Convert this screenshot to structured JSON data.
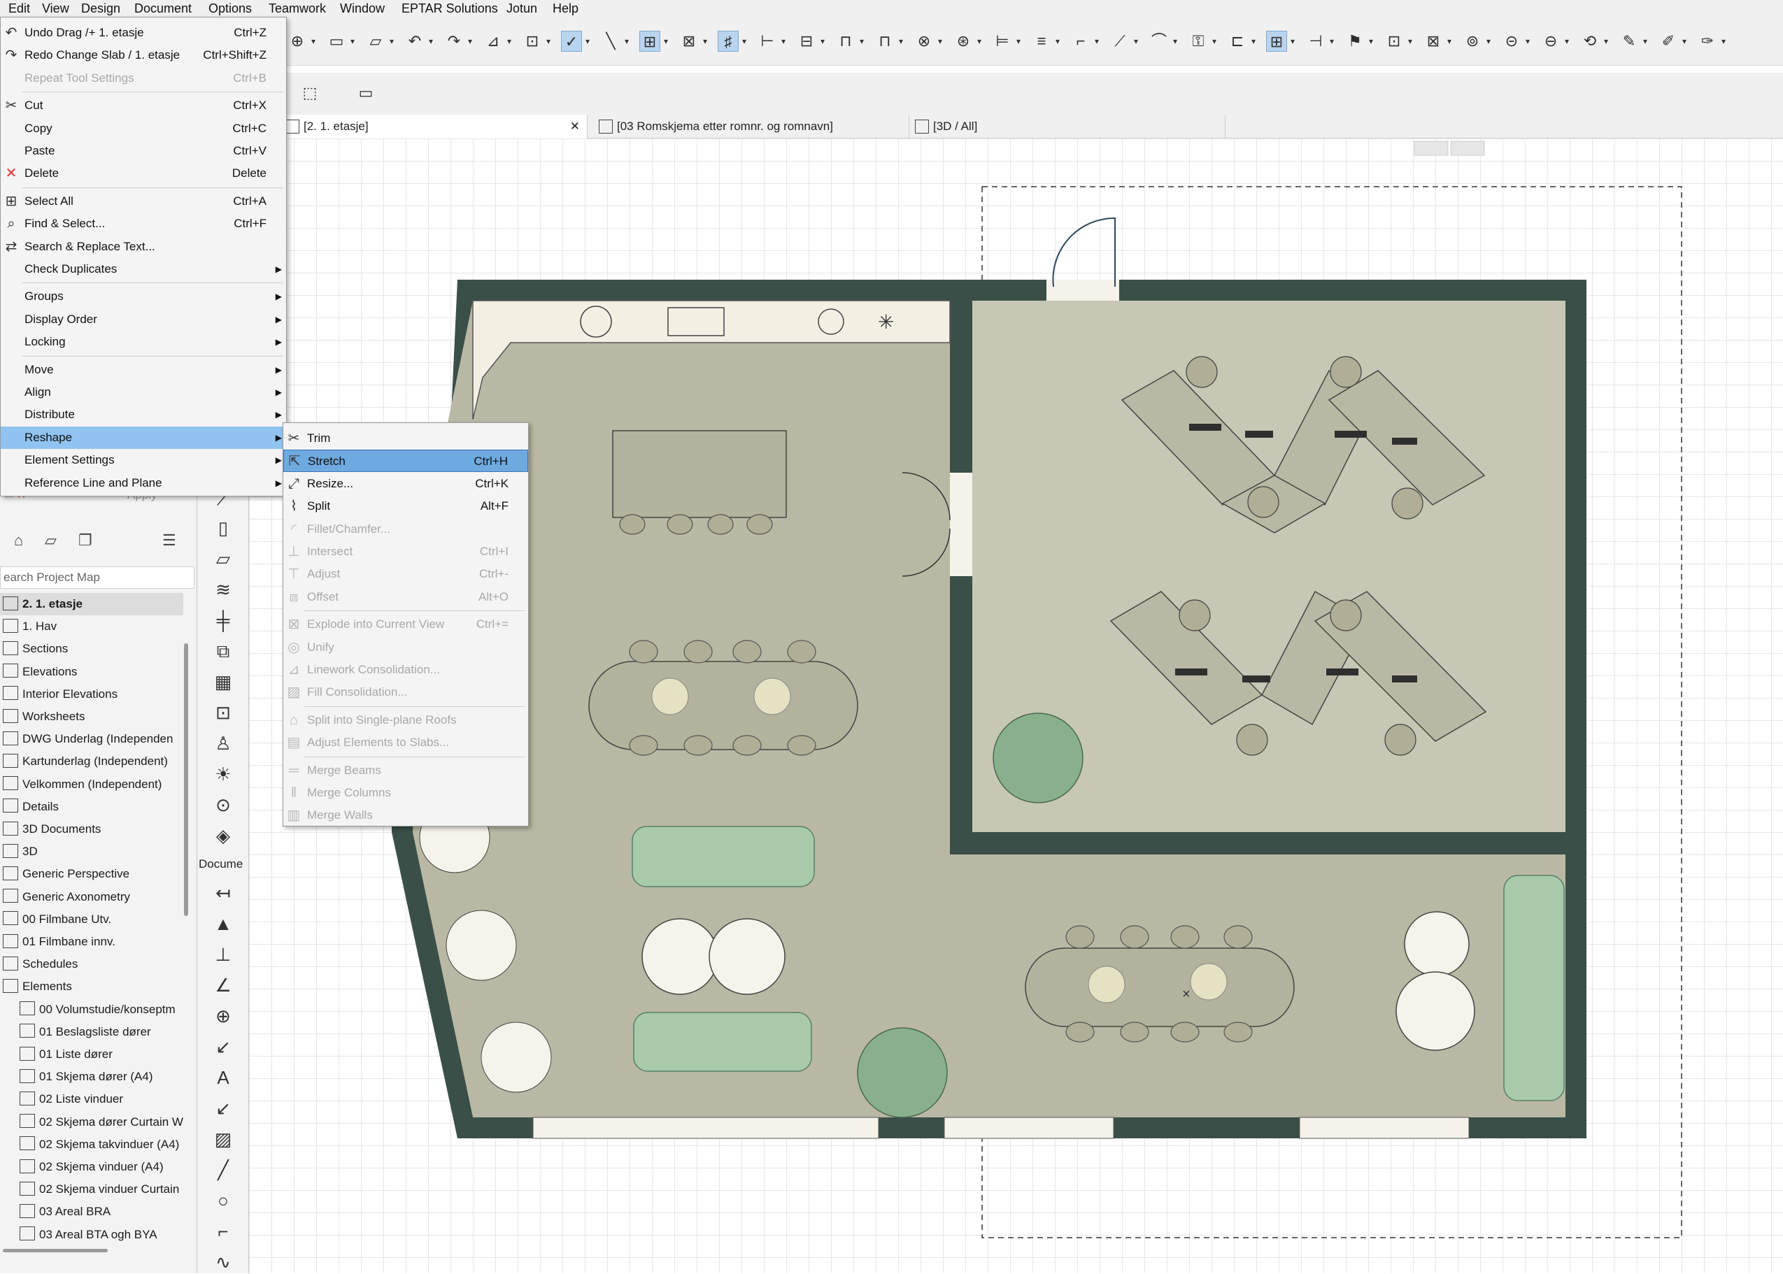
{
  "menubar": [
    "Edit",
    "View",
    "Design",
    "Document",
    "Options",
    "Teamwork",
    "Window",
    "EPTAR Solutions",
    "Jotun",
    "Help"
  ],
  "tabs": [
    {
      "label": "[2. 1. etasje]",
      "icon": "floorplan-icon"
    },
    {
      "label": "[03 Romskjema etter romnr. og romnavn]",
      "icon": "schedule-icon"
    },
    {
      "label": "[3D / All]",
      "icon": "3d-icon"
    }
  ],
  "edit_menu": [
    {
      "label": "Undo Drag /+ 1. etasje",
      "shortcut": "Ctrl+Z",
      "icon": "undo-icon",
      "disabled": false
    },
    {
      "label": "Redo Change Slab / 1. etasje",
      "shortcut": "Ctrl+Shift+Z",
      "icon": "redo-icon",
      "disabled": false
    },
    {
      "label": "Repeat Tool Settings",
      "shortcut": "Ctrl+B",
      "icon": "",
      "disabled": true
    },
    {
      "sep": true
    },
    {
      "label": "Cut",
      "shortcut": "Ctrl+X",
      "icon": "scissors-icon",
      "disabled": false
    },
    {
      "label": "Copy",
      "shortcut": "Ctrl+C",
      "icon": "",
      "disabled": false
    },
    {
      "label": "Paste",
      "shortcut": "Ctrl+V",
      "icon": "",
      "disabled": false
    },
    {
      "label": "Delete",
      "shortcut": "Delete",
      "icon": "delete-icon",
      "disabled": false
    },
    {
      "sep": true
    },
    {
      "label": "Select All",
      "shortcut": "Ctrl+A",
      "icon": "select-all-icon",
      "disabled": false
    },
    {
      "label": "Find & Select...",
      "shortcut": "Ctrl+F",
      "icon": "find-icon",
      "disabled": false
    },
    {
      "label": "Search & Replace Text...",
      "shortcut": "",
      "icon": "search-replace-icon",
      "disabled": false
    },
    {
      "label": "Check Duplicates",
      "shortcut": "",
      "icon": "",
      "disabled": false,
      "submenu": true
    },
    {
      "sep": true
    },
    {
      "label": "Groups",
      "shortcut": "",
      "icon": "",
      "disabled": false,
      "submenu": true
    },
    {
      "label": "Display Order",
      "shortcut": "",
      "icon": "",
      "disabled": false,
      "submenu": true
    },
    {
      "label": "Locking",
      "shortcut": "",
      "icon": "",
      "disabled": false,
      "submenu": true
    },
    {
      "sep": true
    },
    {
      "label": "Move",
      "shortcut": "",
      "icon": "",
      "disabled": false,
      "submenu": true
    },
    {
      "label": "Align",
      "shortcut": "",
      "icon": "",
      "disabled": false,
      "submenu": true
    },
    {
      "label": "Distribute",
      "shortcut": "",
      "icon": "",
      "disabled": false,
      "submenu": true
    },
    {
      "label": "Reshape",
      "shortcut": "",
      "icon": "",
      "disabled": false,
      "submenu": true,
      "highlighted": true
    },
    {
      "label": "Element Settings",
      "shortcut": "",
      "icon": "",
      "disabled": false,
      "submenu": true
    },
    {
      "label": "Reference Line and Plane",
      "shortcut": "",
      "icon": "",
      "disabled": false,
      "submenu": true
    }
  ],
  "reshape_menu": [
    {
      "label": "Trim",
      "shortcut": "",
      "icon": "trim-icon",
      "disabled": false
    },
    {
      "label": "Stretch",
      "shortcut": "Ctrl+H",
      "icon": "stretch-icon",
      "disabled": false,
      "highlighted": true
    },
    {
      "label": "Resize...",
      "shortcut": "Ctrl+K",
      "icon": "resize-icon",
      "disabled": false
    },
    {
      "label": "Split",
      "shortcut": "Alt+F",
      "icon": "split-icon",
      "disabled": false
    },
    {
      "label": "Fillet/Chamfer...",
      "shortcut": "",
      "icon": "fillet-icon",
      "disabled": true
    },
    {
      "label": "Intersect",
      "shortcut": "Ctrl+I",
      "icon": "intersect-icon",
      "disabled": true
    },
    {
      "label": "Adjust",
      "shortcut": "Ctrl+-",
      "icon": "adjust-icon",
      "disabled": true
    },
    {
      "label": "Offset",
      "shortcut": "Alt+O",
      "icon": "offset-icon",
      "disabled": true
    },
    {
      "sep": true
    },
    {
      "label": "Explode into Current View",
      "shortcut": "Ctrl+=",
      "icon": "explode-icon",
      "disabled": true
    },
    {
      "label": "Unify",
      "shortcut": "",
      "icon": "unify-icon",
      "disabled": true
    },
    {
      "label": "Linework Consolidation...",
      "shortcut": "",
      "icon": "linework-icon",
      "disabled": true
    },
    {
      "label": "Fill Consolidation...",
      "shortcut": "",
      "icon": "fill-icon",
      "disabled": true
    },
    {
      "sep": true
    },
    {
      "label": "Split into Single-plane Roofs",
      "shortcut": "",
      "icon": "roof-icon",
      "disabled": true
    },
    {
      "label": "Adjust Elements to Slabs...",
      "shortcut": "",
      "icon": "slab-icon",
      "disabled": true
    },
    {
      "sep": true
    },
    {
      "label": "Merge Beams",
      "shortcut": "",
      "icon": "beam-icon",
      "disabled": true
    },
    {
      "label": "Merge Columns",
      "shortcut": "",
      "icon": "column-icon",
      "disabled": true
    },
    {
      "label": "Merge Walls",
      "shortcut": "",
      "icon": "wall-icon",
      "disabled": true
    }
  ],
  "panel": {
    "apply_label": "Apply",
    "search_placeholder": "earch Project Map",
    "toolbox_label": "Docume"
  },
  "project_map": [
    {
      "label": "2. 1. etasje",
      "indent": 0,
      "selected": true
    },
    {
      "label": "1. Hav",
      "indent": 0
    },
    {
      "label": "Sections",
      "indent": 0
    },
    {
      "label": "Elevations",
      "indent": 0
    },
    {
      "label": "Interior Elevations",
      "indent": 0
    },
    {
      "label": "Worksheets",
      "indent": 0
    },
    {
      "label": "DWG Underlag (Independen",
      "indent": 0
    },
    {
      "label": "Kartunderlag (Independent)",
      "indent": 0
    },
    {
      "label": "Velkommen (Independent)",
      "indent": 0
    },
    {
      "label": "Details",
      "indent": 0
    },
    {
      "label": "3D Documents",
      "indent": 0
    },
    {
      "label": "3D",
      "indent": 0
    },
    {
      "label": "Generic Perspective",
      "indent": 0
    },
    {
      "label": "Generic Axonometry",
      "indent": 0
    },
    {
      "label": "00 Filmbane Utv.",
      "indent": 0
    },
    {
      "label": "01 Filmbane innv.",
      "indent": 0
    },
    {
      "label": "Schedules",
      "indent": 0
    },
    {
      "label": "Elements",
      "indent": 0
    },
    {
      "label": "00 Volumstudie/konseptm",
      "indent": 1
    },
    {
      "label": "01 Beslagsliste dører",
      "indent": 1
    },
    {
      "label": "01 Liste dører",
      "indent": 1
    },
    {
      "label": "01 Skjema dører (A4)",
      "indent": 1
    },
    {
      "label": "02 Liste vinduer",
      "indent": 1
    },
    {
      "label": "02 Skjema dører Curtain W",
      "indent": 1
    },
    {
      "label": "02 Skjema takvinduer (A4)",
      "indent": 1
    },
    {
      "label": "02 Skjema vinduer (A4)",
      "indent": 1
    },
    {
      "label": "02 Skjema vinduer Curtain",
      "indent": 1
    },
    {
      "label": "03 Areal BRA",
      "indent": 1
    },
    {
      "label": "03 Areal BTA ogh BYA",
      "indent": 1
    }
  ],
  "colors": {
    "wall": "#3a4f48",
    "floor": "#b9b8a4",
    "floor2": "#c8c9b6",
    "sofa": "#a9c9ab",
    "plant": "#88b08c",
    "highlight": "#90c3f0"
  }
}
